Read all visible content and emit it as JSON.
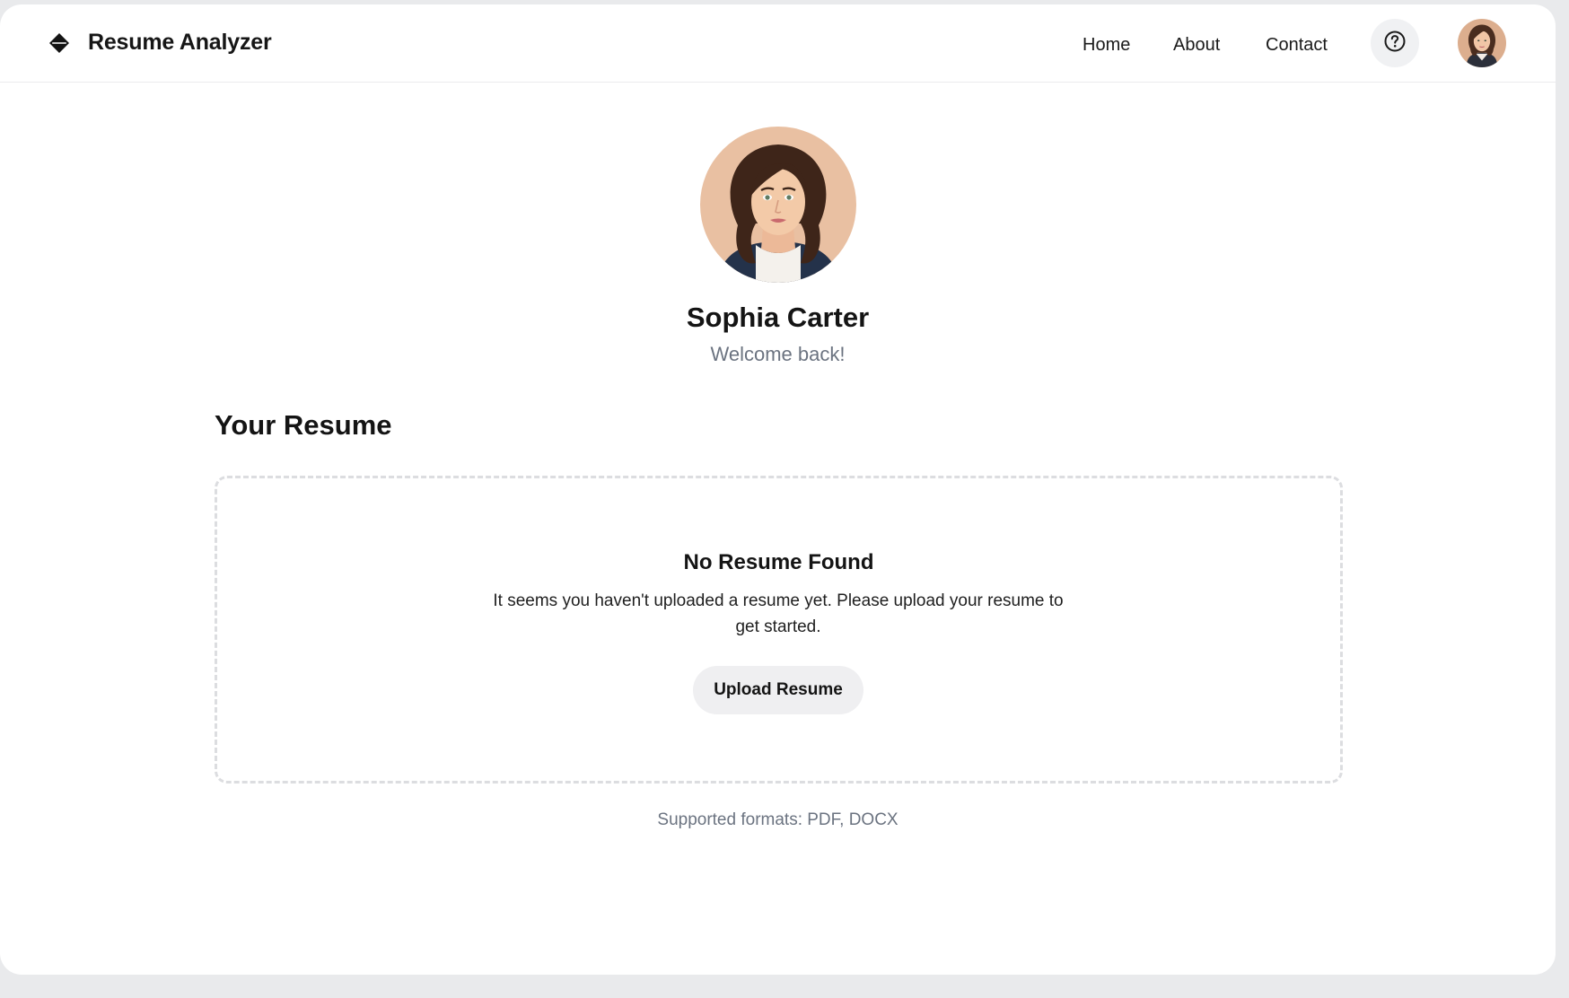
{
  "app": {
    "title": "Resume Analyzer",
    "logo_icon": "diamond-logo-icon"
  },
  "nav": {
    "items": [
      {
        "label": "Home"
      },
      {
        "label": "About"
      },
      {
        "label": "Contact"
      }
    ],
    "help_icon": "question-circle-icon",
    "avatar_icon": "user-avatar"
  },
  "profile": {
    "name": "Sophia Carter",
    "greeting": "Welcome back!"
  },
  "resume": {
    "section_title": "Your Resume",
    "empty_title": "No Resume Found",
    "empty_message": "It seems you haven't uploaded a resume yet. Please upload your resume to get started.",
    "upload_label": "Upload Resume",
    "supported_formats": "Supported formats: PDF, DOCX"
  },
  "colors": {
    "page_background": "#e9eaec",
    "card_background": "#ffffff",
    "muted_text": "#6b7380",
    "button_background": "#efeff1",
    "dashed_border": "#dcdde0"
  }
}
